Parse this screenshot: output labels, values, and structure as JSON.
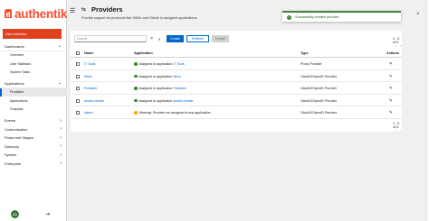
{
  "brand": {
    "name": "authentik",
    "color": "#fd4b2d"
  },
  "sidebar": {
    "user_interface": "User interface",
    "groups": [
      {
        "label": "Dashboards",
        "expanded": true,
        "items": [
          "Overview",
          "User Statistics",
          "System Tasks"
        ]
      },
      {
        "label": "Applications",
        "expanded": true,
        "items": [
          "Providers",
          "Applications",
          "Outposts"
        ],
        "active": "Providers"
      },
      {
        "label": "Events",
        "expanded": false,
        "items": []
      },
      {
        "label": "Customisation",
        "expanded": false,
        "items": []
      },
      {
        "label": "Flows and Stages",
        "expanded": false,
        "items": []
      },
      {
        "label": "Directory",
        "expanded": false,
        "items": []
      },
      {
        "label": "System",
        "expanded": false,
        "items": []
      },
      {
        "label": "Enterprise",
        "expanded": false,
        "items": []
      }
    ],
    "avatar_initials": "AA",
    "accent": "#0066cc"
  },
  "header": {
    "title": "Providers",
    "subtitle": "Provide support for protocols like SAML and OAuth to assigned applications."
  },
  "toast": {
    "message": "Successfully created provider.",
    "color": "#3e8635"
  },
  "toolbar": {
    "search_placeholder": "Search...",
    "create_label": "Create",
    "refresh_label": "Refresh",
    "delete_label": "Delete"
  },
  "pagination": {
    "text": "1 - 5 of 5"
  },
  "table": {
    "columns": [
      "Name",
      "Application",
      "Type",
      "Actions"
    ],
    "rows": [
      {
        "name": "IT Tools",
        "status": "ok",
        "app_prefix": "Assigned to application",
        "app_link": "IT Tools",
        "type": "Proxy Provider"
      },
      {
        "name": "Miniu",
        "status": "ok",
        "app_prefix": "Assigned to application",
        "app_link": "Miniu",
        "type": "OAuth2/OpenID Provider"
      },
      {
        "name": "Portainer",
        "status": "ok",
        "app_prefix": "Assigned to application",
        "app_link": "Portainer",
        "type": "OAuth2/OpenID Provider"
      },
      {
        "name": "docker-render",
        "status": "ok",
        "app_prefix": "Assigned to application",
        "app_link": "docker-render",
        "type": "OAuth2/OpenID Provider"
      },
      {
        "name": "lubelo",
        "status": "warn",
        "app_prefix": "Warning: Provider not assigned to any application",
        "app_link": "",
        "type": "OAuth2/OpenID Provider"
      }
    ]
  }
}
